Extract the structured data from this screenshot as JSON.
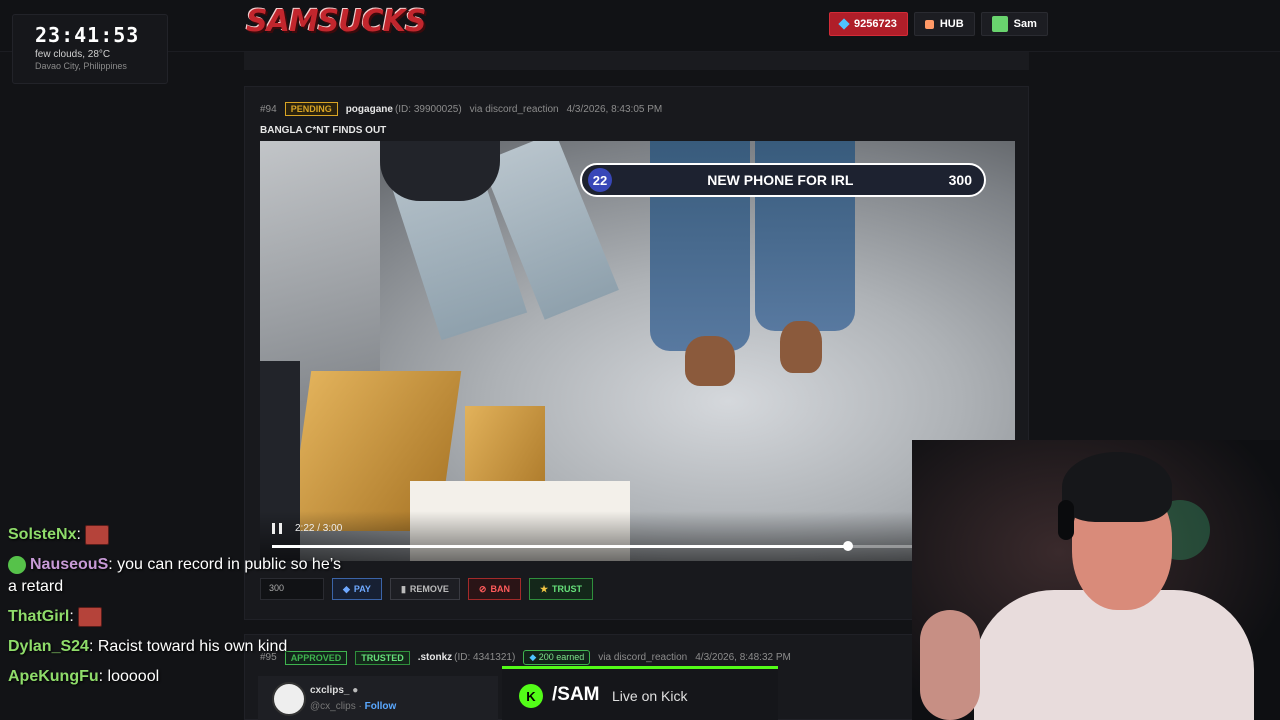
{
  "clock": {
    "time": "23:41:53",
    "weather": "few clouds, 28°C",
    "location": "Davao City, Philippines"
  },
  "brand": {
    "logo": "SAMSUCKS"
  },
  "header": {
    "points": "9256723",
    "hub_label": "HUB",
    "user_label": "Sam"
  },
  "submission": {
    "index": "#94",
    "status": "PENDING",
    "user": "pogagane",
    "user_id": "(ID: 39900025)",
    "source": "via discord_reaction",
    "timestamp": "4/3/2026, 8:43:05 PM",
    "title": "BANGLA C*NT FINDS OUT",
    "amount_value": "300",
    "actions": {
      "pay": "PAY",
      "remove": "REMOVE",
      "ban": "BAN",
      "trust": "TRUST"
    }
  },
  "video_overlay": {
    "rank": "22",
    "label": "NEW PHONE FOR IRL",
    "value": "300"
  },
  "player": {
    "time": "2:22 / 3:00",
    "progress_fraction": 0.789
  },
  "submission2": {
    "index": "#95",
    "status": "APPROVED",
    "trusted": "TRUSTED",
    "user": ".stonkz",
    "user_id": "(ID: 4341321)",
    "earned": "200 earned",
    "source": "via discord_reaction",
    "timestamp": "4/3/2026, 8:48:32 PM"
  },
  "embed": {
    "name": "cxclips_",
    "handle": "@cx_clips",
    "separator": "·",
    "follow": "Follow"
  },
  "kick": {
    "logo": "K",
    "channel": "/SAM",
    "status": "Live on Kick"
  },
  "chat": [
    {
      "user": "SolsteNx",
      "color": "#8fdc6a",
      "text": ""
    },
    {
      "user": "NauseouS",
      "color": "#c79ad6",
      "text": "you can record in public so he’s a retard"
    },
    {
      "user": "ThatGirl",
      "color": "#8fdc6a",
      "text": ""
    },
    {
      "user": "Dylan_S24",
      "color": "#8fdc6a",
      "text": "Racist toward his own kind"
    },
    {
      "user": "ApeKungFu",
      "color": "#8fdc6a",
      "text": "loooool"
    }
  ],
  "colors": {
    "accent_red": "#b01e29",
    "kick_green": "#53fc18",
    "pending": "#d8a425",
    "approved": "#3fb34f"
  }
}
